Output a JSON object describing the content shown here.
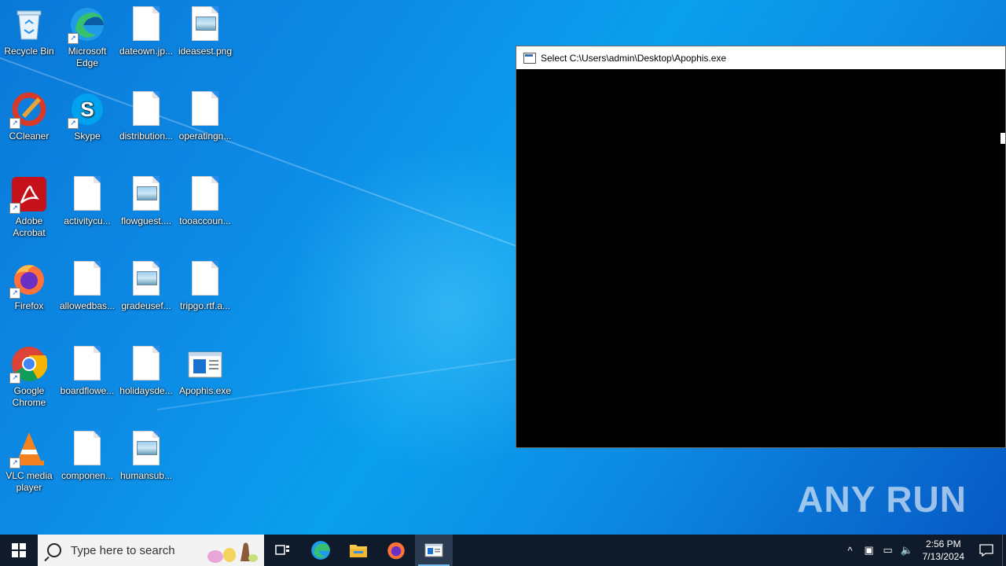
{
  "desktop": {
    "icons": [
      {
        "label": "Recycle Bin"
      },
      {
        "label": "Microsoft Edge"
      },
      {
        "label": "dateown.jp..."
      },
      {
        "label": "ideasest.png"
      },
      {
        "label": "CCleaner"
      },
      {
        "label": "Skype"
      },
      {
        "label": "distribution..."
      },
      {
        "label": "operatingn..."
      },
      {
        "label": "Adobe Acrobat"
      },
      {
        "label": "activitycu..."
      },
      {
        "label": "flowguest...."
      },
      {
        "label": "tooaccoun..."
      },
      {
        "label": "Firefox"
      },
      {
        "label": "allowedbas..."
      },
      {
        "label": "gradeusef..."
      },
      {
        "label": "tripgo.rtf.a..."
      },
      {
        "label": "Google Chrome"
      },
      {
        "label": "boardflowe..."
      },
      {
        "label": "holidaysde..."
      },
      {
        "label": "Apophis.exe"
      },
      {
        "label": "VLC media player"
      },
      {
        "label": "componen..."
      },
      {
        "label": "humansub..."
      }
    ]
  },
  "console_window": {
    "title": "Select C:\\Users\\admin\\Desktop\\Apophis.exe"
  },
  "watermark": "ANY RUN",
  "taskbar": {
    "search_placeholder": "Type here to search",
    "clock_time": "2:56 PM",
    "clock_date": "7/13/2024"
  },
  "colors": {
    "taskbar_bg": "#0f1a2a",
    "console_bg": "#000000"
  }
}
